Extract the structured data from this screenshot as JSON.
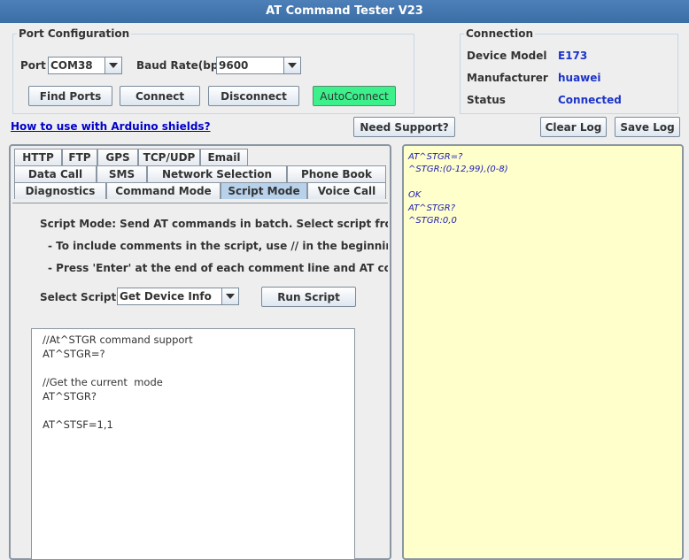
{
  "window": {
    "title": "AT Command Tester V23"
  },
  "port_config": {
    "legend": "Port Configuration",
    "port_label": "Port",
    "port_value": "COM38",
    "baud_label": "Baud Rate(bps)",
    "baud_value": "9600",
    "buttons": {
      "find_ports": "Find Ports",
      "connect": "Connect",
      "disconnect": "Disconnect",
      "autoconnect": "AutoConnect"
    },
    "autoconnect_color": "#3cf08c"
  },
  "connection": {
    "legend": "Connection",
    "device_model_label": "Device Model",
    "device_model_value": "E173",
    "manufacturer_label": "Manufacturer",
    "manufacturer_value": "huawei",
    "status_label": "Status",
    "status_value": "Connected",
    "value_color": "#1c34c8"
  },
  "links": {
    "arduino": "How to use with Arduino shields?"
  },
  "toolbar": {
    "need_support": "Need Support?",
    "clear_log": "Clear Log",
    "save_log": "Save Log"
  },
  "tabs": {
    "row1": [
      "HTTP",
      "FTP",
      "GPS",
      "TCP/UDP",
      "Email"
    ],
    "row2": [
      "Data Call",
      "SMS",
      "Network Selection",
      "Phone Book"
    ],
    "row3": [
      "Diagnostics",
      "Command Mode",
      "Script Mode",
      "Voice Call"
    ],
    "active": "Script Mode"
  },
  "script_mode": {
    "description": [
      "Script Mode: Send AT commands in batch. Select script from the drop",
      "- To include comments in the script, use // in the beginning of the line",
      "- Press 'Enter' at the end of each comment line and AT command line"
    ],
    "select_label": "Select Script",
    "select_value": "Get Device Info",
    "run_button": "Run Script",
    "script_lines": [
      "//At^STGR command support",
      "AT^STGR=?",
      "",
      "//Get the current  mode",
      "AT^STGR?",
      "",
      "AT^STSF=1,1"
    ]
  },
  "log": {
    "lines": [
      "AT^STGR=?",
      "^STGR:(0-12,99),(0-8)",
      "",
      "OK",
      "AT^STGR?",
      "^STGR:0,0"
    ],
    "background": "#ffffcc",
    "text_color": "#1c1cb0"
  },
  "icons": {
    "dropdown": "chevron-down-icon"
  }
}
